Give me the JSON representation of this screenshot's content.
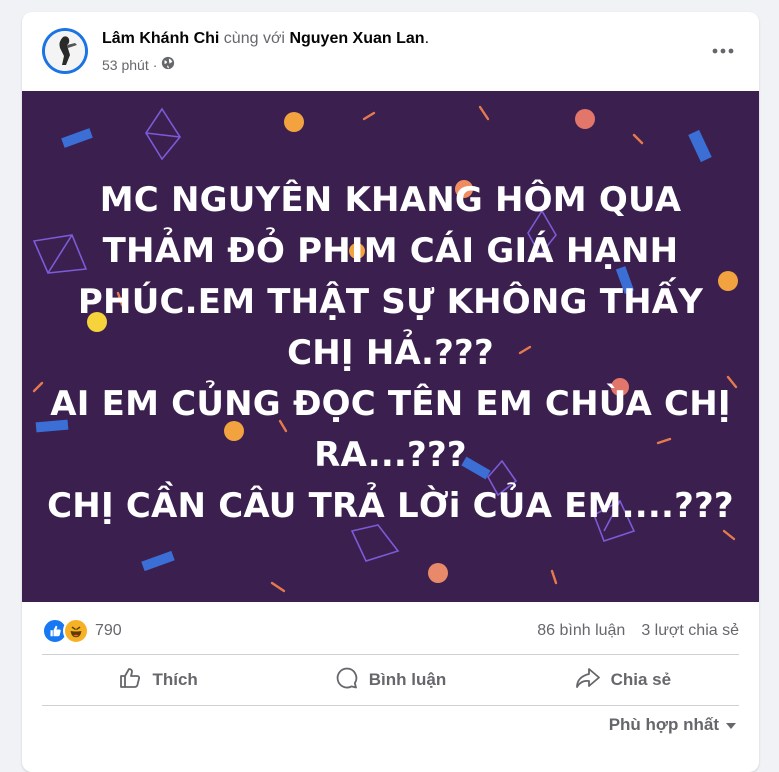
{
  "post": {
    "author": "Lâm Khánh Chi",
    "with_text": "cùng với",
    "tagged": "Nguyen Xuan Lan",
    "tagged_suffix": ".",
    "time": "53 phút",
    "separator": "·",
    "privacy_icon": "globe-icon",
    "more_icon": "more-options-icon"
  },
  "banner": {
    "background": "#3a1f4f",
    "lines": [
      "MC NGUYÊN KHANG HÔM QUA",
      "THẢM ĐỎ PHIM CÁI GIÁ HẠNH",
      "PHÚC.EM THẬT SỰ KHÔNG THẤY",
      "CHỊ HẢ.???",
      "AI EM CỦNG ĐỌC TÊN EM CHÙA CHỊ",
      "RA...???",
      "CHỊ CẦN CÂU TRẢ LỜi CỦA EM....???"
    ]
  },
  "stats": {
    "reaction_icons": [
      "like-icon",
      "haha-icon"
    ],
    "reaction_count": "790",
    "comments": "86 bình luận",
    "shares": "3 lượt chia sẻ"
  },
  "actions": {
    "like": "Thích",
    "comment": "Bình luận",
    "share": "Chia sẻ"
  },
  "sort": {
    "label": "Phù hợp nhất"
  },
  "colors": {
    "like_blue": "#1877f2",
    "haha_yellow": "#f7b125",
    "muted_text": "#65676b"
  }
}
